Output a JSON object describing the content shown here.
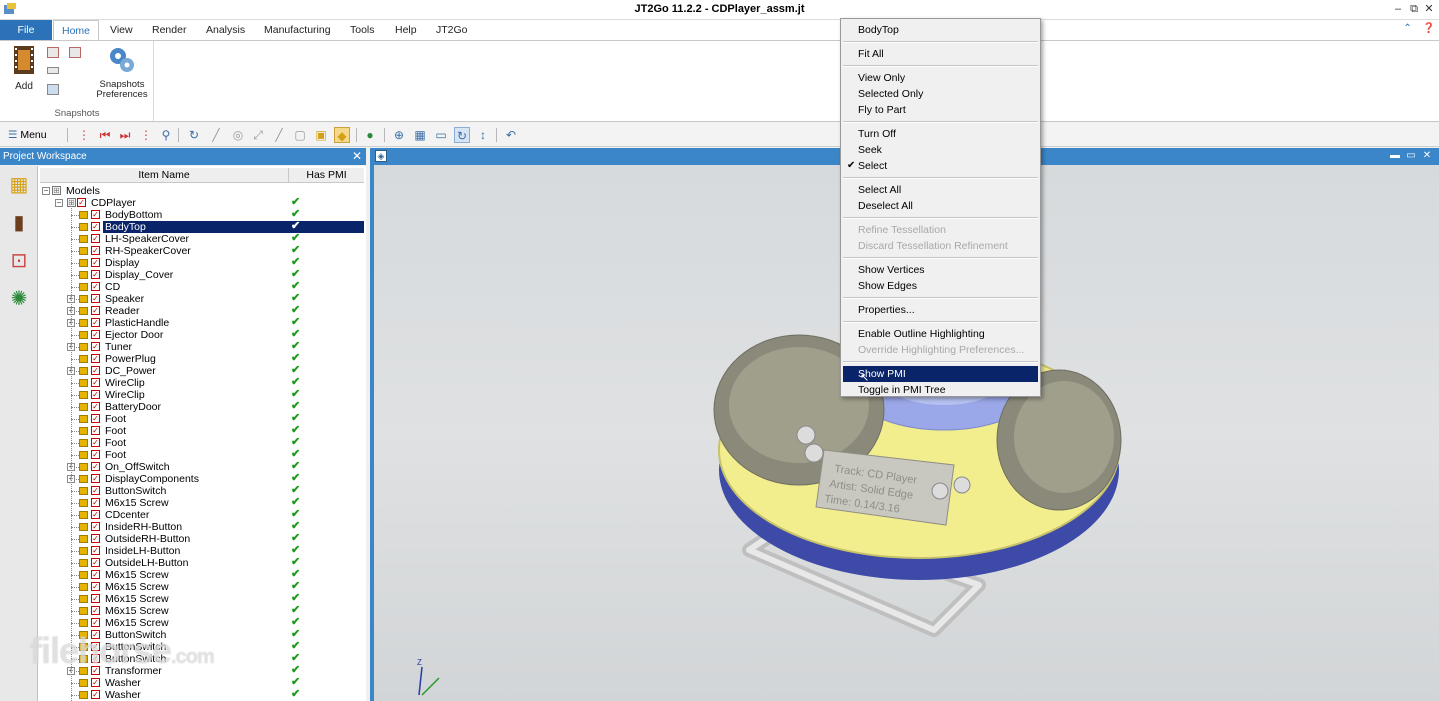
{
  "window": {
    "title": "JT2Go 11.2.2 - CDPlayer_assm.jt",
    "controls": [
      "–",
      "⧉",
      "✕"
    ]
  },
  "ribbon": {
    "tabs": [
      "File",
      "Home",
      "View",
      "Render",
      "Analysis",
      "Manufacturing",
      "Tools",
      "Help",
      "JT2Go"
    ],
    "active_tab": "Home",
    "add_label": "Add",
    "snapshots_preferences_label": "Snapshots Preferences",
    "group_label": "Snapshots"
  },
  "toolbar": {
    "menu_label": "Menu"
  },
  "workspace": {
    "title": "Project Workspace",
    "columns": [
      "Item Name",
      "Has PMI"
    ],
    "root": "Models",
    "assembly": "CDPlayer",
    "items": [
      {
        "name": "BodyBottom",
        "expand": false
      },
      {
        "name": "BodyTop",
        "expand": false,
        "selected": true
      },
      {
        "name": "LH-SpeakerCover",
        "expand": false
      },
      {
        "name": "RH-SpeakerCover",
        "expand": false
      },
      {
        "name": "Display",
        "expand": false
      },
      {
        "name": "Display_Cover",
        "expand": false
      },
      {
        "name": "CD",
        "expand": false
      },
      {
        "name": "Speaker",
        "expand": true
      },
      {
        "name": "Reader",
        "expand": true
      },
      {
        "name": "PlasticHandle",
        "expand": true
      },
      {
        "name": "Ejector Door",
        "expand": false
      },
      {
        "name": "Tuner",
        "expand": true
      },
      {
        "name": "PowerPlug",
        "expand": false
      },
      {
        "name": "DC_Power",
        "expand": true
      },
      {
        "name": "WireClip",
        "expand": false
      },
      {
        "name": "WireClip",
        "expand": false
      },
      {
        "name": "BatteryDoor",
        "expand": false
      },
      {
        "name": "Foot",
        "expand": false
      },
      {
        "name": "Foot",
        "expand": false
      },
      {
        "name": "Foot",
        "expand": false
      },
      {
        "name": "Foot",
        "expand": false
      },
      {
        "name": "On_OffSwitch",
        "expand": true
      },
      {
        "name": "DisplayComponents",
        "expand": true
      },
      {
        "name": "ButtonSwitch",
        "expand": false
      },
      {
        "name": "M6x15 Screw",
        "expand": false
      },
      {
        "name": "CDcenter",
        "expand": false
      },
      {
        "name": "InsideRH-Button",
        "expand": false
      },
      {
        "name": "OutsideRH-Button",
        "expand": false
      },
      {
        "name": "InsideLH-Button",
        "expand": false
      },
      {
        "name": "OutsideLH-Button",
        "expand": false
      },
      {
        "name": "M6x15 Screw",
        "expand": false
      },
      {
        "name": "M6x15 Screw",
        "expand": false
      },
      {
        "name": "M6x15 Screw",
        "expand": false
      },
      {
        "name": "M6x15 Screw",
        "expand": false
      },
      {
        "name": "M6x15 Screw",
        "expand": false
      },
      {
        "name": "ButtonSwitch",
        "expand": false
      },
      {
        "name": "ButtonSwitch",
        "expand": false
      },
      {
        "name": "ButtonSwitch",
        "expand": false
      },
      {
        "name": "Transformer",
        "expand": true
      },
      {
        "name": "Washer",
        "expand": false
      },
      {
        "name": "Washer",
        "expand": false
      }
    ]
  },
  "context_menu": {
    "items": [
      {
        "label": "BodyTop",
        "disabled": false
      },
      {
        "sep": true
      },
      {
        "label": "Fit All",
        "disabled": false
      },
      {
        "sep": true
      },
      {
        "label": "View Only",
        "disabled": false
      },
      {
        "label": "Selected Only",
        "disabled": false
      },
      {
        "label": "Fly to Part",
        "disabled": false
      },
      {
        "sep": true
      },
      {
        "label": "Turn Off",
        "disabled": false
      },
      {
        "label": "Seek",
        "disabled": false
      },
      {
        "label": "Select",
        "disabled": false,
        "checked": true
      },
      {
        "sep": true
      },
      {
        "label": "Select All",
        "disabled": false
      },
      {
        "label": "Deselect All",
        "disabled": false
      },
      {
        "sep": true
      },
      {
        "label": "Refine Tessellation",
        "disabled": true
      },
      {
        "label": "Discard Tessellation Refinement",
        "disabled": true
      },
      {
        "sep": true
      },
      {
        "label": "Show Vertices",
        "disabled": false
      },
      {
        "label": "Show Edges",
        "disabled": false
      },
      {
        "sep": true
      },
      {
        "label": "Properties...",
        "disabled": false
      },
      {
        "sep": true
      },
      {
        "label": "Enable Outline Highlighting",
        "disabled": false
      },
      {
        "label": "Override Highlighting Preferences...",
        "disabled": true
      },
      {
        "sep": true
      },
      {
        "label": "Show PMI",
        "disabled": false,
        "highlighted": true
      },
      {
        "label": "Toggle in PMI Tree",
        "disabled": false
      }
    ]
  },
  "model_display_text": [
    "Track: CD Player",
    "Artist: Solid Edge",
    "Time: 0.14/3.16"
  ],
  "triad_label": "Z",
  "watermark": {
    "main": "filehorse",
    "suffix": ".com"
  },
  "colors": {
    "accent": "#3b86c8",
    "selection": "#0a246a",
    "check_green": "#1e9a1e",
    "body_yellow": "#f2ee8e",
    "body_blue": "#3d4aa8"
  }
}
